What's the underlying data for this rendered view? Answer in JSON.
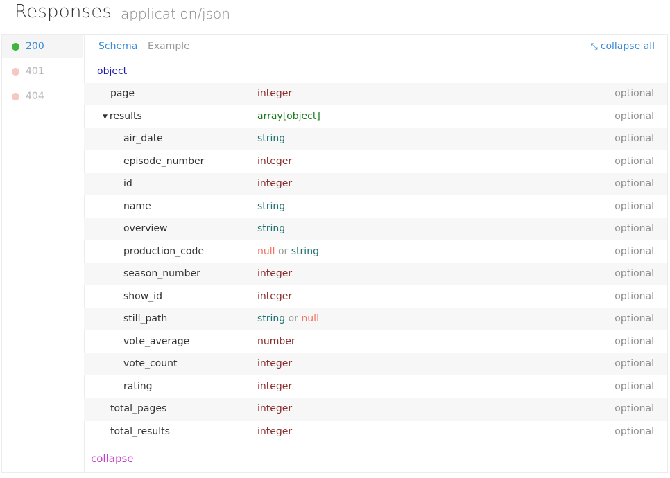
{
  "header": {
    "title": "Responses",
    "content_type": "application/json"
  },
  "codes": [
    {
      "label": "200",
      "dot_color": "#3fb43f",
      "text_color": "#3a8bd8",
      "active": true
    },
    {
      "label": "401",
      "dot_color": "#f7c7c2",
      "text_color": "#b8b8b8",
      "active": false
    },
    {
      "label": "404",
      "dot_color": "#f7c7c2",
      "text_color": "#b8b8b8",
      "active": false
    }
  ],
  "tabs": {
    "schema": "Schema",
    "example": "Example",
    "collapse_all": "collapse all"
  },
  "schema": {
    "root_type": "object",
    "rows": [
      {
        "name": "page",
        "types": [
          "integer"
        ],
        "req": "optional",
        "depth": 1,
        "expandable": false
      },
      {
        "name": "results",
        "types": [
          "array[object]"
        ],
        "req": "optional",
        "depth": 1,
        "expandable": true
      },
      {
        "name": "air_date",
        "types": [
          "string"
        ],
        "req": "optional",
        "depth": 2,
        "expandable": false
      },
      {
        "name": "episode_number",
        "types": [
          "integer"
        ],
        "req": "optional",
        "depth": 2,
        "expandable": false
      },
      {
        "name": "id",
        "types": [
          "integer"
        ],
        "req": "optional",
        "depth": 2,
        "expandable": false
      },
      {
        "name": "name",
        "types": [
          "string"
        ],
        "req": "optional",
        "depth": 2,
        "expandable": false
      },
      {
        "name": "overview",
        "types": [
          "string"
        ],
        "req": "optional",
        "depth": 2,
        "expandable": false
      },
      {
        "name": "production_code",
        "types": [
          "null",
          "string"
        ],
        "req": "optional",
        "depth": 2,
        "expandable": false
      },
      {
        "name": "season_number",
        "types": [
          "integer"
        ],
        "req": "optional",
        "depth": 2,
        "expandable": false
      },
      {
        "name": "show_id",
        "types": [
          "integer"
        ],
        "req": "optional",
        "depth": 2,
        "expandable": false
      },
      {
        "name": "still_path",
        "types": [
          "string",
          "null"
        ],
        "req": "optional",
        "depth": 2,
        "expandable": false
      },
      {
        "name": "vote_average",
        "types": [
          "number"
        ],
        "req": "optional",
        "depth": 2,
        "expandable": false
      },
      {
        "name": "vote_count",
        "types": [
          "integer"
        ],
        "req": "optional",
        "depth": 2,
        "expandable": false
      },
      {
        "name": "rating",
        "types": [
          "integer"
        ],
        "req": "optional",
        "depth": 2,
        "expandable": false
      },
      {
        "name": "total_pages",
        "types": [
          "integer"
        ],
        "req": "optional",
        "depth": 1,
        "expandable": false
      },
      {
        "name": "total_results",
        "types": [
          "integer"
        ],
        "req": "optional",
        "depth": 1,
        "expandable": false
      }
    ],
    "or_word": "or"
  },
  "footer": {
    "collapse": "collapse"
  },
  "colors": {
    "accent": "#3a8bd8",
    "collapse": "#c63bd1",
    "object": "#1a1aa6"
  }
}
